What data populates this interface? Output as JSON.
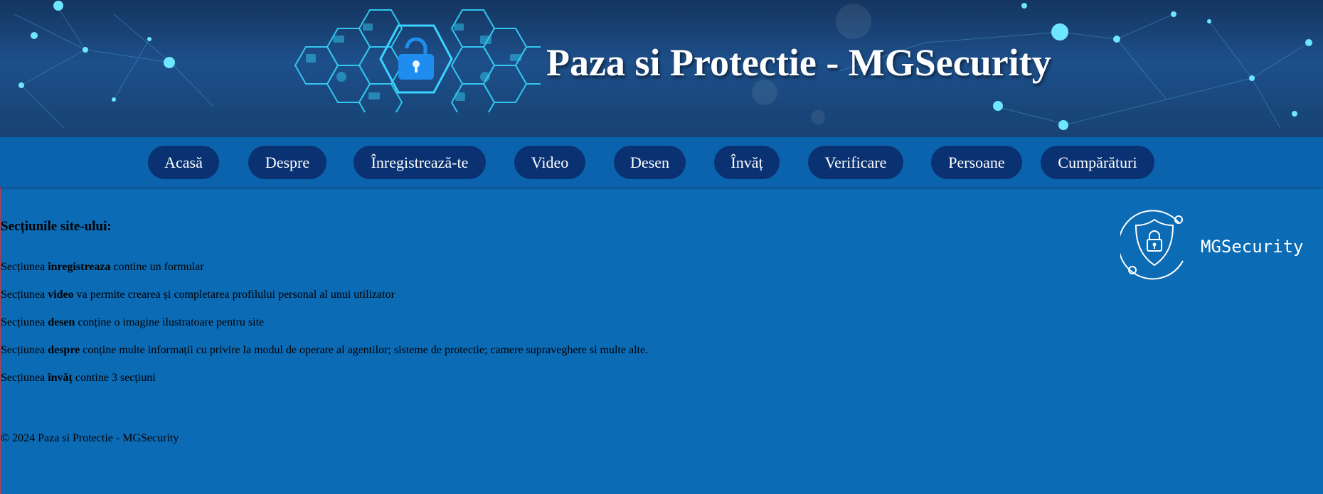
{
  "header": {
    "title": "Paza si Protectie - MGSecurity"
  },
  "nav": {
    "items": [
      {
        "label": "Acasă"
      },
      {
        "label": "Despre"
      },
      {
        "label": "Înregistrează-te"
      },
      {
        "label": "Video"
      },
      {
        "label": "Desen"
      },
      {
        "label": "Învăț"
      },
      {
        "label": "Verificare"
      },
      {
        "label": "Persoane"
      },
      {
        "label": "Cumpărături"
      }
    ]
  },
  "main": {
    "heading": "Secțiunile site-ului:",
    "sections": [
      {
        "prefix": "Secțiunea ",
        "keyword": "înregistreaza",
        "text": " contine un formular"
      },
      {
        "prefix": "Secțiunea ",
        "keyword": "video",
        "text": " va permite crearea și completarea profilului personal al unui utilizator"
      },
      {
        "prefix": "Secțiunea ",
        "keyword": "desen",
        "text": " conține o imagine ilustratoare pentru site"
      },
      {
        "prefix": "Secțiunea ",
        "keyword": "despre",
        "text": " conține multe informații cu privire la modul de operare al agentilor; sisteme de protectie; camere supraveghere si multe alte."
      },
      {
        "prefix": "Secțiunea ",
        "keyword": "învăț",
        "text": " contine 3 secțiuni"
      }
    ]
  },
  "logo": {
    "text": "MGSecurity",
    "icon": "shield-lock-icon"
  },
  "footer": {
    "text": "© 2024 Paza si Protectie - MGSecurity"
  },
  "colors": {
    "page_background": "#0c6bb5",
    "nav_background": "#0b63ad",
    "nav_button": "#0a3272",
    "header_dark": "#14355f"
  }
}
